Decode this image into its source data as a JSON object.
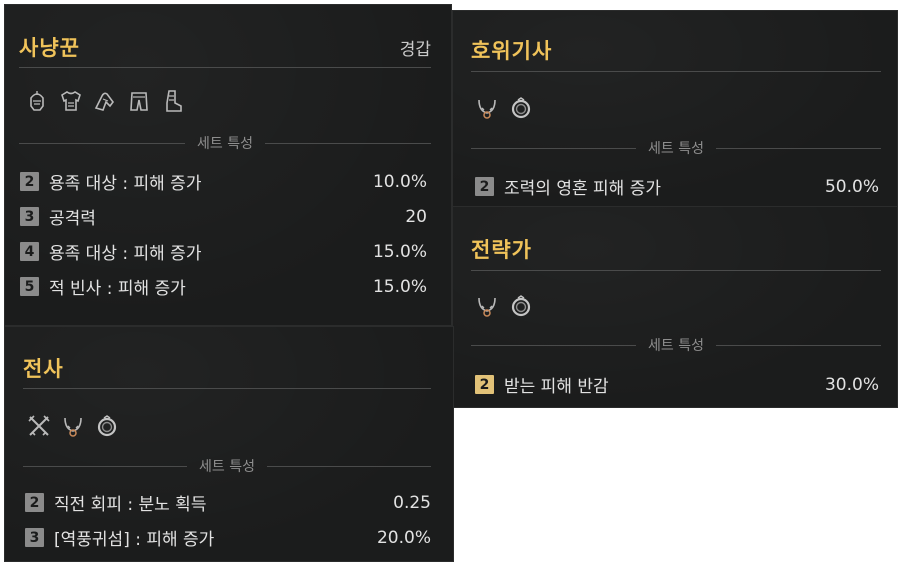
{
  "hunter": {
    "title": "사냥꾼",
    "armor_type": "경갑",
    "icons": [
      "helmet-icon",
      "chest-armor-icon",
      "gloves-icon",
      "pants-icon",
      "boots-icon"
    ],
    "set_header": "세트 특성",
    "effects": [
      {
        "count": "2",
        "label": "용족 대상 : 피해 증가",
        "value": "10.0%"
      },
      {
        "count": "3",
        "label": "공격력",
        "value": "20"
      },
      {
        "count": "4",
        "label": "용족 대상 : 피해 증가",
        "value": "15.0%"
      },
      {
        "count": "5",
        "label": "적 빈사 : 피해 증가",
        "value": "15.0%"
      }
    ]
  },
  "guard": {
    "title": "호위기사",
    "icons": [
      "necklace-icon",
      "ring-icon"
    ],
    "set_header": "세트 특성",
    "effects": [
      {
        "count": "2",
        "label": "조력의 영혼 피해 증가",
        "value": "50.0%"
      }
    ]
  },
  "strategist": {
    "title": "전략가",
    "icons": [
      "necklace-icon",
      "ring-icon"
    ],
    "set_header": "세트 특성",
    "effects": [
      {
        "count": "2",
        "label": "받는 피해 반감",
        "value": "30.0%"
      }
    ]
  },
  "warrior": {
    "title": "전사",
    "icons": [
      "crossed-weapons-icon",
      "necklace-icon",
      "ring-icon"
    ],
    "set_header": "세트 특성",
    "effects": [
      {
        "count": "2",
        "label": "직전 회피 : 분노 획득",
        "value": "0.25"
      },
      {
        "count": "3",
        "label": "[역풍귀섬] : 피해 증가",
        "value": "20.0%"
      }
    ]
  },
  "colors": {
    "title": "#f0c35a",
    "badge_gray": "#8b8b8b",
    "badge_gold": "#e2c278",
    "panel_bg": "#1b1c1c"
  }
}
